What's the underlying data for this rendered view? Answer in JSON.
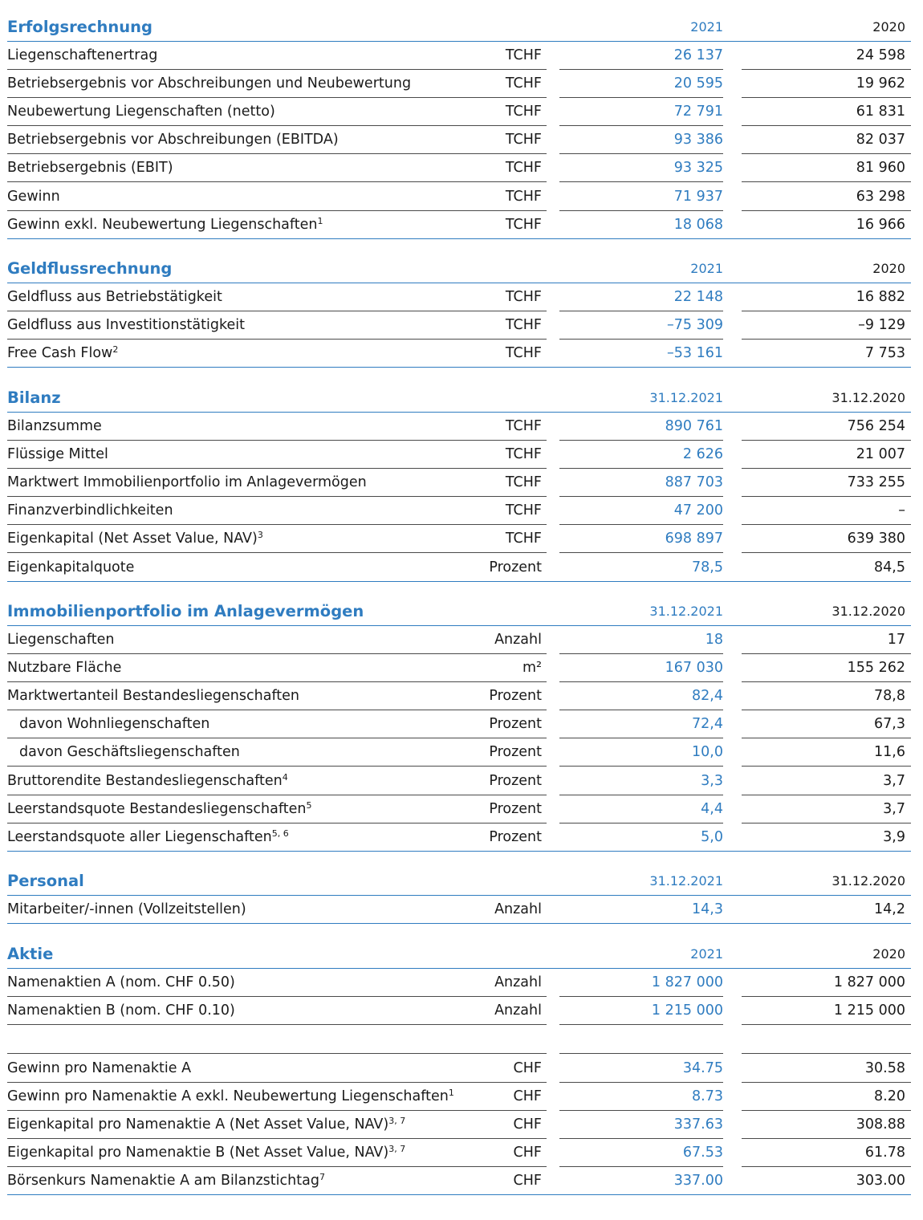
{
  "sections": [
    {
      "title": "Erfolgsrechnung",
      "col1": "2021",
      "col2": "2020",
      "rows": [
        {
          "label": "Liegenschaftenertrag",
          "fn": "",
          "unit": "TCHF",
          "v1": "26 137",
          "v2": "24 598"
        },
        {
          "label": "Betriebsergebnis vor Abschreibungen und Neubewertung",
          "fn": "",
          "unit": "TCHF",
          "v1": "20 595",
          "v2": "19 962"
        },
        {
          "label": "Neubewertung Liegenschaften (netto)",
          "fn": "",
          "unit": "TCHF",
          "v1": "72 791",
          "v2": "61 831"
        },
        {
          "label": "Betriebsergebnis vor Abschreibungen (EBITDA)",
          "fn": "",
          "unit": "TCHF",
          "v1": "93 386",
          "v2": "82 037"
        },
        {
          "label": "Betriebsergebnis (EBIT)",
          "fn": "",
          "unit": "TCHF",
          "v1": "93 325",
          "v2": "81 960"
        },
        {
          "label": "Gewinn",
          "fn": "",
          "unit": "TCHF",
          "v1": "71 937",
          "v2": "63 298"
        },
        {
          "label": "Gewinn exkl. Neubewertung Liegenschaften",
          "fn": "1",
          "unit": "TCHF",
          "v1": "18 068",
          "v2": "16 966"
        }
      ]
    },
    {
      "title": "Geldflussrechnung",
      "col1": "2021",
      "col2": "2020",
      "rows": [
        {
          "label": "Geldfluss aus Betriebstätigkeit",
          "fn": "",
          "unit": "TCHF",
          "v1": "22 148",
          "v2": "16 882"
        },
        {
          "label": "Geldfluss aus Investitionstätigkeit",
          "fn": "",
          "unit": "TCHF",
          "v1": "–75 309",
          "v2": "–9 129"
        },
        {
          "label": "Free Cash Flow",
          "fn": "2",
          "unit": "TCHF",
          "v1": "–53 161",
          "v2": "7 753"
        }
      ]
    },
    {
      "title": "Bilanz",
      "col1": "31.12.2021",
      "col2": "31.12.2020",
      "rows": [
        {
          "label": "Bilanzsumme",
          "fn": "",
          "unit": "TCHF",
          "v1": "890 761",
          "v2": "756 254"
        },
        {
          "label": "Flüssige Mittel",
          "fn": "",
          "unit": "TCHF",
          "v1": "2 626",
          "v2": "21 007"
        },
        {
          "label": "Marktwert Immobilienportfolio im Anlagevermögen",
          "fn": "",
          "unit": "TCHF",
          "v1": "887 703",
          "v2": "733 255"
        },
        {
          "label": "Finanzverbindlichkeiten",
          "fn": "",
          "unit": "TCHF",
          "v1": "47 200",
          "v2": "–"
        },
        {
          "label": "Eigenkapital (Net Asset Value, NAV)",
          "fn": "3",
          "unit": "TCHF",
          "v1": "698 897",
          "v2": "639 380"
        },
        {
          "label": "Eigenkapitalquote",
          "fn": "",
          "unit": "Prozent",
          "v1": "78,5",
          "v2": "84,5"
        }
      ]
    },
    {
      "title": "Immobilienportfolio im Anlagevermögen",
      "col1": "31.12.2021",
      "col2": "31.12.2020",
      "rows": [
        {
          "label": "Liegenschaften",
          "fn": "",
          "unit": "Anzahl",
          "v1": "18",
          "v2": "17"
        },
        {
          "label": "Nutzbare Fläche",
          "fn": "",
          "unit": "m²",
          "v1": "167 030",
          "v2": "155 262"
        },
        {
          "label": "Marktwertanteil Bestandesliegenschaften",
          "fn": "",
          "unit": "Prozent",
          "v1": "82,4",
          "v2": "78,8"
        },
        {
          "label": "davon Wohnliegenschaften",
          "fn": "",
          "unit": "Prozent",
          "v1": "72,4",
          "v2": "67,3",
          "indent": true
        },
        {
          "label": "davon Geschäftsliegenschaften",
          "fn": "",
          "unit": "Prozent",
          "v1": "10,0",
          "v2": "11,6",
          "indent": true
        },
        {
          "label": "Bruttorendite Bestandesliegenschaften",
          "fn": "4",
          "unit": "Prozent",
          "v1": "3,3",
          "v2": "3,7"
        },
        {
          "label": "Leerstandsquote Bestandesliegenschaften",
          "fn": "5",
          "unit": "Prozent",
          "v1": "4,4",
          "v2": "3,7"
        },
        {
          "label": "Leerstandsquote aller Liegenschaften",
          "fn": "5, 6",
          "unit": "Prozent",
          "v1": "5,0",
          "v2": "3,9"
        }
      ]
    },
    {
      "title": "Personal",
      "col1": "31.12.2021",
      "col2": "31.12.2020",
      "rows": [
        {
          "label": "Mitarbeiter/-innen (Vollzeitstellen)",
          "fn": "",
          "unit": "Anzahl",
          "v1": "14,3",
          "v2": "14,2"
        }
      ]
    },
    {
      "title": "Aktie",
      "col1": "2021",
      "col2": "2020",
      "rows": [
        {
          "label": "Namenaktien A (nom. CHF 0.50)",
          "fn": "",
          "unit": "Anzahl",
          "v1": "1 827 000",
          "v2": "1 827 000"
        },
        {
          "label": "Namenaktien B (nom. CHF 0.10)",
          "fn": "",
          "unit": "Anzahl",
          "v1": "1 215 000",
          "v2": "1 215 000"
        }
      ],
      "rows_b": [
        {
          "label": "Gewinn pro Namenaktie A",
          "fn": "",
          "unit": "CHF",
          "v1": "34.75",
          "v2": "30.58"
        },
        {
          "label": "Gewinn pro Namenaktie A exkl. Neubewertung Liegenschaften",
          "fn": "1",
          "unit": "CHF",
          "v1": "8.73",
          "v2": "8.20"
        },
        {
          "label": "Eigenkapital pro Namenaktie A (Net Asset Value, NAV)",
          "fn": "3, 7",
          "unit": "CHF",
          "v1": "337.63",
          "v2": "308.88"
        },
        {
          "label": "Eigenkapital pro Namenaktie B (Net Asset Value, NAV)",
          "fn": "3, 7",
          "unit": "CHF",
          "v1": "67.53",
          "v2": "61.78"
        },
        {
          "label": "Börsenkurs Namenaktie A am Bilanzstichtag",
          "fn": "7",
          "unit": "CHF",
          "v1": "337.00",
          "v2": "303.00"
        }
      ]
    }
  ]
}
